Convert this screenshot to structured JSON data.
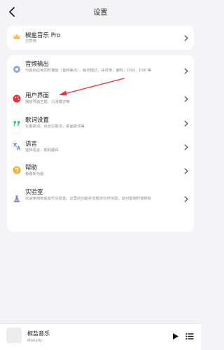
{
  "header": {
    "title": "设置"
  },
  "pro": {
    "label": "椒盐音乐 Pro",
    "desc": "已禁用"
  },
  "settings": [
    {
      "label": "音频输出",
      "desc": "与其他应用同时播放（音频焦点），输出模式，采样率，解码，DSD，DSP 等"
    },
    {
      "label": "用户界面",
      "desc": "播放界面主题，沉浸模式等"
    },
    {
      "label": "歌词设置",
      "desc": "车载歌词，状态栏歌词，桌面歌词等"
    },
    {
      "label": "语言",
      "desc": "选择语言，帮助翻译"
    },
    {
      "label": "帮助",
      "desc": "看看新功能"
    },
    {
      "label": "实验室",
      "desc": "欢迎使用椒盐音乐实验室，这里的功能并非稳定仅供体验，其可能随时被移除"
    }
  ],
  "player": {
    "song": "椒盐音乐",
    "artist": "Moriafly"
  },
  "colors": {
    "accent": "#e8333c",
    "background": "#f4f4f6",
    "card": "#ffffff",
    "pro_icon": "#f2c14e",
    "audio_icon": "#8fa6cf",
    "ui_icon": "#e8333c",
    "lyrics_icon": "#34c98a",
    "language_icon": "#6a7fd6",
    "help_icon": "#f2b233",
    "lab_icon": "#7b8db3"
  },
  "icons": {
    "back": "chevron-left-icon",
    "pro": "crown-icon",
    "audio": "audio-output-icon",
    "ui": "palette-icon",
    "lyrics": "quote-icon",
    "language": "translate-icon",
    "help": "help-icon",
    "lab": "flask-icon",
    "row_chevron": "chevron-right-icon",
    "play": "play-icon",
    "queue": "playlist-icon"
  }
}
